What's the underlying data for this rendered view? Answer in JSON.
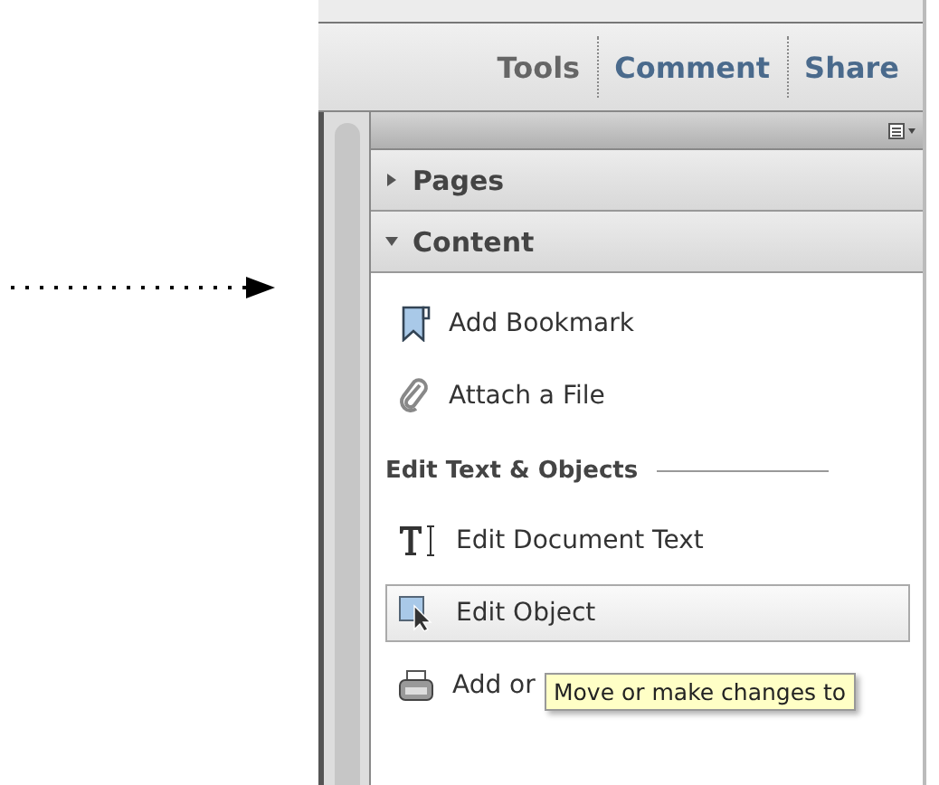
{
  "tabs": [
    {
      "label": "Tools",
      "selected": true
    },
    {
      "label": "Comment",
      "selected": false
    },
    {
      "label": "Share",
      "selected": false
    }
  ],
  "sections": [
    {
      "title": "Pages",
      "expanded": false
    },
    {
      "title": "Content",
      "expanded": true
    }
  ],
  "content_items": [
    {
      "kind": "bookmark",
      "label": "Add Bookmark",
      "selected": false
    },
    {
      "kind": "attach",
      "label": "Attach a File",
      "selected": false
    }
  ],
  "group": {
    "title": "Edit Text & Objects",
    "items": [
      {
        "kind": "text",
        "label": "Edit Document Text",
        "selected": false
      },
      {
        "kind": "object",
        "label": "Edit Object",
        "selected": true
      },
      {
        "kind": "typewriter",
        "label": "Add or",
        "selected": false
      }
    ]
  },
  "tooltip": "Move or make changes to"
}
